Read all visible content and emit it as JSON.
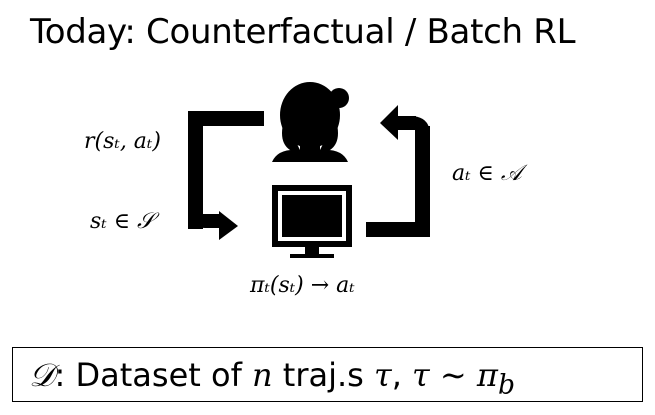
{
  "slide": {
    "title": "Today: Counterfactual / Batch RL"
  },
  "diagram": {
    "labels": {
      "reward": "r(sₜ, aₜ)",
      "state": "sₜ ∈ 𝒮",
      "action": "aₜ ∈ 𝒜",
      "policy": "πₜ(sₜ) → aₜ"
    },
    "icons": {
      "agent": "person-head-icon",
      "environment": "computer-monitor-icon",
      "left_arrow": "loop-arrow-down-right-icon",
      "right_arrow": "loop-arrow-up-left-icon"
    },
    "colors": {
      "ink": "#000000",
      "background": "#ffffff"
    }
  },
  "dataset": {
    "symbol": "𝒟",
    "text_prefix": ":  Dataset of ",
    "n": "n",
    "text_mid": " traj.s ",
    "tau": "τ",
    "comma": ", ",
    "tau_dist": "τ ∼ π",
    "sub_b": "b"
  }
}
